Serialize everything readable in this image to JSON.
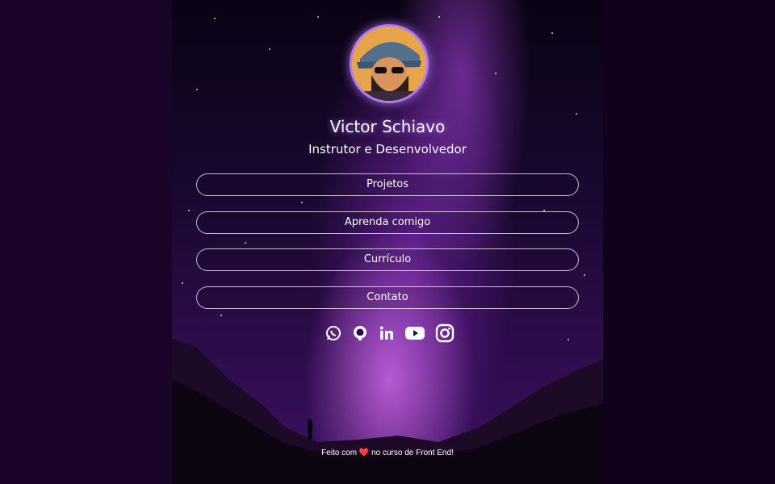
{
  "profile": {
    "name": "Victor Schiavo",
    "role": "Instrutor e Desenvolvedor"
  },
  "links": [
    {
      "label": "Projetos"
    },
    {
      "label": "Aprenda comigo"
    },
    {
      "label": "Currículo"
    },
    {
      "label": "Contato"
    }
  ],
  "social": [
    {
      "icon": "whatsapp-icon"
    },
    {
      "icon": "github-icon"
    },
    {
      "icon": "linkedin-icon"
    },
    {
      "icon": "youtube-icon"
    },
    {
      "icon": "instagram-icon"
    }
  ],
  "footer": {
    "prefix": "Feito com",
    "heart": "❤️",
    "suffix": "no curso de Front End!"
  },
  "colors": {
    "accent": "#b07cf0",
    "background": "#12011e",
    "text": "#ffffff"
  }
}
